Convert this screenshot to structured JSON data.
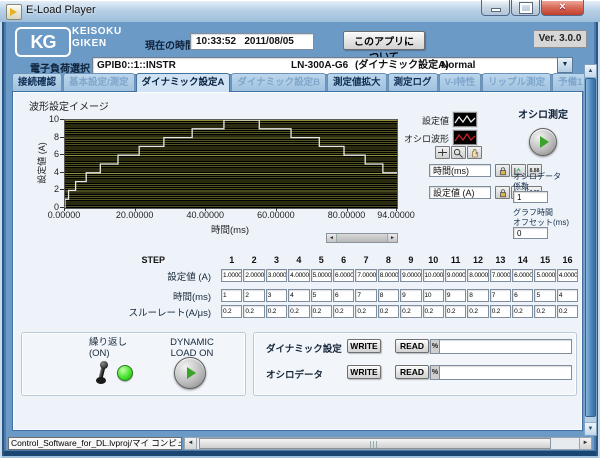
{
  "window": {
    "title": "E-Load Player"
  },
  "header": {
    "logo_kg": "KG",
    "logo_name_line1": "KEISOKU",
    "logo_name_line2": "GIKEN",
    "clock_label": "現在の時間",
    "clock_value": "10:33:52   2011/08/05",
    "about_button": "このアプリについて",
    "version": "Ver. 3.0.0"
  },
  "device_row": {
    "label": "電子負荷選択",
    "visa_address": "GPIB0::1::INSTR",
    "model": "LN-300A-G6",
    "mode": "(ダイナミック設定A)",
    "status": "Normal"
  },
  "tabs": [
    {
      "name": "tab-connection-check",
      "label": "接続確認",
      "state": "normal"
    },
    {
      "name": "tab-basic-setting-measure",
      "label": "基本設定/測定",
      "state": "disabled"
    },
    {
      "name": "tab-dynamic-setting-a",
      "label": "ダイナミック設定A",
      "state": "active"
    },
    {
      "name": "tab-dynamic-setting-b",
      "label": "ダイナミック設定B",
      "state": "disabled"
    },
    {
      "name": "tab-measure-zoom",
      "label": "測定値拡大",
      "state": "normal"
    },
    {
      "name": "tab-measure-log",
      "label": "測定ログ",
      "state": "normal"
    },
    {
      "name": "tab-vi-characteristic",
      "label": "V-I特性",
      "state": "disabled"
    },
    {
      "name": "tab-ripple-measure",
      "label": "リップル測定",
      "state": "disabled"
    },
    {
      "name": "tab-spare-1",
      "label": "予備1",
      "state": "disabled"
    }
  ],
  "chart_data": {
    "type": "line",
    "title": "波形設定イメージ",
    "xlabel": "時間(ms)",
    "ylabel": "設定値 (A)",
    "xlim": [
      0,
      94
    ],
    "ylim": [
      0,
      10
    ],
    "x_tick_values": [
      0,
      20,
      40,
      60,
      80,
      94
    ],
    "x_tick_labels": [
      "0.00000",
      "20.00000",
      "40.00000",
      "60.00000",
      "80.00000",
      "94.00000"
    ],
    "y_tick_values": [
      0,
      2,
      4,
      6,
      8,
      10
    ],
    "step_amplitudes_A": [
      1,
      2,
      3,
      4,
      5,
      6,
      7,
      8,
      9,
      10,
      9,
      8,
      7,
      6,
      5,
      4
    ],
    "step_durations_ms": [
      1,
      2,
      3,
      4,
      5,
      6,
      7,
      8,
      9,
      10,
      9,
      8,
      7,
      6,
      5,
      4
    ],
    "line_color": "#e8e8e8",
    "plot_bg": "#000000",
    "grid_color": "#69692a",
    "legend": [
      {
        "label": "設定値",
        "color": "#e8e8e8"
      },
      {
        "label": "オシロ波形",
        "color": "#cc2222"
      }
    ]
  },
  "graph_controls": {
    "x_scale_label": "時間(ms)",
    "y_scale_label": "設定値 (A)",
    "x_format_glyph": "8.88",
    "y_format_glyph": "8.88"
  },
  "osc_panel": {
    "measure_label": "オシロ測定",
    "coef_label_line1": "オシロデータ",
    "coef_label_line2": "係数",
    "coef_value": "1",
    "offset_label_line1": "グラフ時間",
    "offset_label_line2": "オフセット(ms)",
    "offset_value": "0"
  },
  "step_table": {
    "corner_label": "STEP",
    "columns": [
      "1",
      "2",
      "3",
      "4",
      "5",
      "6",
      "7",
      "8",
      "9",
      "10",
      "11",
      "12",
      "13",
      "14",
      "15",
      "16"
    ],
    "rows": [
      {
        "label": "設定値 (A)",
        "values": [
          "1.0000",
          "2.0000",
          "3.0000",
          "4.0000",
          "5.0000",
          "6.0000",
          "7.0000",
          "8.0000",
          "9.0000",
          "10.0000",
          "9.0000",
          "8.0000",
          "7.0000",
          "6.0000",
          "5.0000",
          "4.0000"
        ]
      },
      {
        "label": "時間(ms)",
        "values": [
          "1",
          "2",
          "3",
          "4",
          "5",
          "6",
          "7",
          "8",
          "9",
          "10",
          "9",
          "8",
          "7",
          "6",
          "5",
          "4"
        ]
      },
      {
        "label": "スルーレート(A/μs)",
        "values": [
          "0.2",
          "0.2",
          "0.2",
          "0.2",
          "0.2",
          "0.2",
          "0.2",
          "0.2",
          "0.2",
          "0.2",
          "0.2",
          "0.2",
          "0.2",
          "0.2",
          "0.2",
          "0.2"
        ]
      }
    ]
  },
  "repeat_group": {
    "repeat_label_line1": "繰り返し",
    "repeat_label_line2": "(ON)",
    "dynamic_label_line1": "DYNAMIC",
    "dynamic_label_line2": "LOAD ON",
    "led_color": "#33dd22"
  },
  "io_group": {
    "rows": [
      {
        "label": "ダイナミック設定",
        "write": "WRITE",
        "read": "READ",
        "field_value": "%"
      },
      {
        "label": "オシロデータ",
        "write": "WRITE",
        "read": "READ",
        "field_value": "%"
      }
    ]
  },
  "status_bar": {
    "project_label": "Control_Software_for_DL.lvproj/マイ コンピュータ"
  }
}
